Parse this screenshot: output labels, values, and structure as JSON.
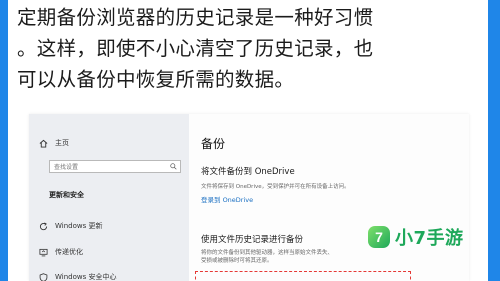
{
  "article": {
    "lines": [
      "定期备份浏览器的历史记录是一种好习惯",
      "。这样，即使不小心清空了历史记录，也",
      "可以从备份中恢复所需的数据。"
    ]
  },
  "settings": {
    "sidebar": {
      "home": "主页",
      "search_placeholder": "查找设置",
      "section": "更新和安全",
      "items": [
        "Windows 更新",
        "传递优化",
        "Windows 安全中心"
      ]
    },
    "main": {
      "title": "备份",
      "onedrive_heading": "将文件备份到 OneDrive",
      "onedrive_desc": [
        "文件将保存到 OneDrive，受到保护并可在所有设备上访问。"
      ],
      "onedrive_link": "登录到 OneDrive",
      "history_heading": "使用文件历史记录进行备份",
      "history_desc": [
        "将你的文件备份到其他驱动器，这样当原始文件丢失、",
        "受损或被删除时可将其还原。"
      ]
    }
  },
  "watermark": {
    "badge": "7",
    "text": "小7手游"
  },
  "colors": {
    "frame": "#1f86e8",
    "sidebar_bg": "#eceef2",
    "link": "#1a6fc2",
    "highlight": "#e53935",
    "logo": "#1ea85a"
  }
}
